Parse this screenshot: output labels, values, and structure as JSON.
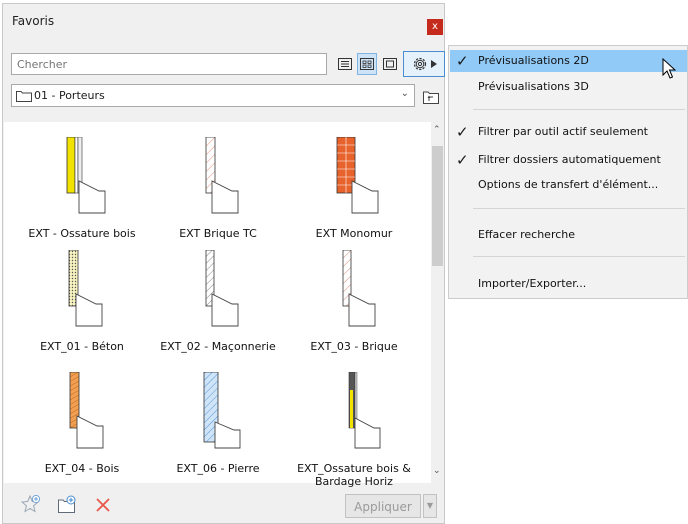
{
  "palette": {
    "title": "Favoris",
    "close_label": "x",
    "search_placeholder": "Chercher",
    "folder": "01 - Porteurs",
    "apply_label": "Appliquer",
    "items": [
      {
        "label": "EXT - Ossature bois"
      },
      {
        "label": "EXT Brique TC"
      },
      {
        "label": "EXT Monomur"
      },
      {
        "label": "EXT_01 - Béton"
      },
      {
        "label": "EXT_02 - Maçonnerie"
      },
      {
        "label": "EXT_03 - Brique"
      },
      {
        "label": "EXT_04 - Bois"
      },
      {
        "label": "EXT_06 - Pierre"
      },
      {
        "label": "EXT_Ossature bois & Bardage Horiz"
      }
    ]
  },
  "menu": {
    "items": [
      {
        "label": "Prévisualisations 2D",
        "checked": true,
        "highlighted": true
      },
      {
        "label": "Prévisualisations 3D",
        "checked": false
      },
      {
        "label": "Filtrer par outil actif seulement",
        "checked": true
      },
      {
        "label": "Filtrer dossiers automatiquement",
        "checked": true
      },
      {
        "label": "Options de transfert d'élément...",
        "checked": false
      },
      {
        "label": "Effacer recherche",
        "checked": false
      },
      {
        "label": "Importer/Exporter...",
        "checked": false
      }
    ]
  },
  "icons": {
    "check": "✓",
    "view_list": "list-view-icon",
    "view_grid": "grid-view-icon",
    "view_single": "single-view-icon",
    "settings": "gear-icon",
    "add_favorite": "add-favorite-icon",
    "new_folder": "new-folder-icon",
    "delete": "delete-icon",
    "folder_up": "folder-up-icon"
  },
  "colors": {
    "accent": "#91c9f7",
    "close": "#c42b1c",
    "delete": "#e8574a"
  }
}
